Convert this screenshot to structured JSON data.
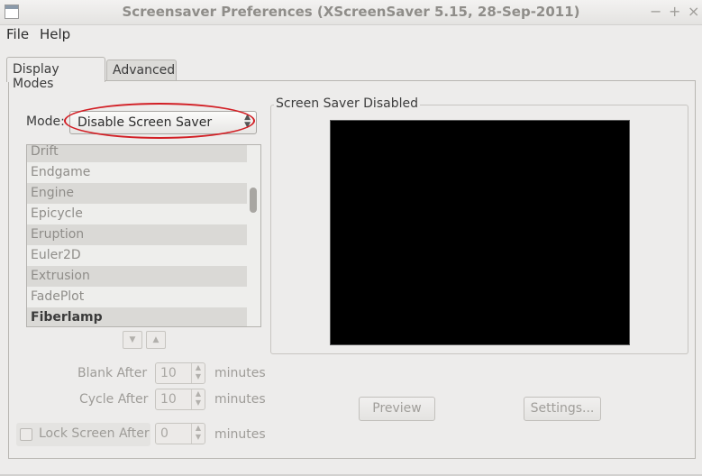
{
  "window": {
    "title": "Screensaver Preferences  (XScreenSaver 5.15, 28-Sep-2011)",
    "controls": [
      "−",
      "+",
      "×"
    ]
  },
  "menu": {
    "file": "File",
    "help": "Help"
  },
  "tabs": {
    "display_modes": "Display Modes",
    "advanced": "Advanced"
  },
  "mode": {
    "label": "Mode:",
    "value": "Disable Screen Saver"
  },
  "hacks": {
    "items": [
      "Drift",
      "Endgame",
      "Engine",
      "Epicycle",
      "Eruption",
      "Euler2D",
      "Extrusion",
      "FadePlot",
      "Fiberlamp"
    ],
    "selected": "Fiberlamp"
  },
  "preview": {
    "label": "Screen Saver Disabled"
  },
  "blank_after": {
    "label": "Blank After",
    "value": "10",
    "unit": "minutes"
  },
  "cycle_after": {
    "label": "Cycle After",
    "value": "10",
    "unit": "minutes"
  },
  "lock_screen": {
    "label": "Lock Screen After",
    "value": "0",
    "unit": "minutes",
    "checked": false
  },
  "buttons": {
    "preview": "Preview",
    "settings": "Settings..."
  },
  "icons": {
    "list_down": "down-arrow-icon",
    "list_up": "up-arrow-icon"
  }
}
